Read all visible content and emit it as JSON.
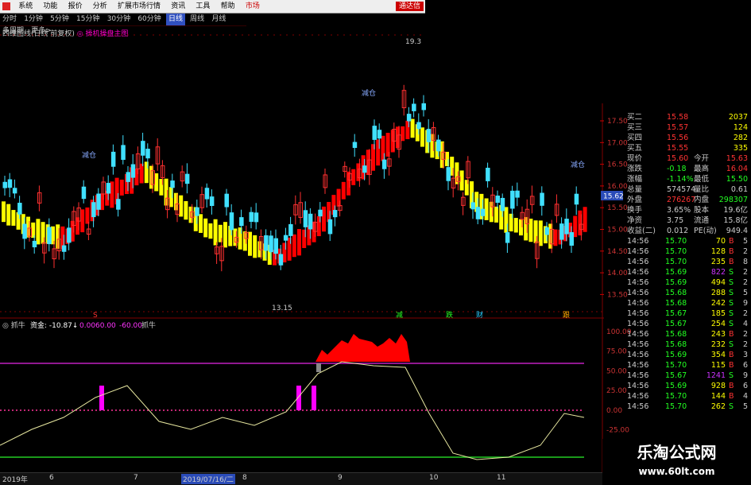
{
  "menu": [
    "系统",
    "功能",
    "报价",
    "分析",
    "扩展市场行情",
    "资讯",
    "工具",
    "帮助",
    "市场"
  ],
  "quick_trade": "通达信",
  "periods": [
    "分时",
    "1分钟",
    "5分钟",
    "15分钟",
    "30分钟",
    "60分钟",
    "日线",
    "周线",
    "月线",
    "多周期",
    "更多>"
  ],
  "active_period": "日线",
  "chart_title": "四维图线(日线 前复权)",
  "chart_title_tag": "◎ 操机操盘主图",
  "price_axis": [
    "17.50",
    "17.00",
    "16.50",
    "16.00",
    "15.50",
    "15.00",
    "14.50",
    "14.00",
    "13.50"
  ],
  "price_flag": "15.62",
  "annotations": {
    "high": "19.3",
    "low": "13.15",
    "reduce1": "减仓",
    "reduce2": "减仓",
    "reduce3": "减仓"
  },
  "signals": [
    "S",
    "减",
    "跌",
    "财",
    "跟"
  ],
  "indicator_header": {
    "name": "◎ 抓牛",
    "funds": "资金: -10.87↓",
    "v1": "0.00",
    "v2": "60.00",
    "v3": "-60.00",
    "name2": "抓牛"
  },
  "indicator_axis": [
    "100.00",
    "75.00",
    "50.00",
    "25.00",
    "0.00",
    "-25.00"
  ],
  "bottom_dates": {
    "d1": "2019年",
    "d2": "6",
    "d3": "7",
    "flag": "2019/07/16/二",
    "d4": "8",
    "d5": "9",
    "d6": "10",
    "d7": "11"
  },
  "quote_book": [
    {
      "label": "买二",
      "price": "15.58",
      "vol": "2037"
    },
    {
      "label": "买三",
      "price": "15.57",
      "vol": "124"
    },
    {
      "label": "买四",
      "price": "15.56",
      "vol": "282"
    },
    {
      "label": "买五",
      "price": "15.55",
      "vol": "335"
    }
  ],
  "quote_stats": [
    {
      "l1": "现价",
      "v1": "15.60",
      "l2": "今开",
      "v2": "15.63"
    },
    {
      "l1": "涨跌",
      "v1": "-0.18",
      "l2": "最高",
      "v2": "16.04"
    },
    {
      "l1": "涨幅",
      "v1": "-1.14%",
      "l2": "最低",
      "v2": "15.50"
    },
    {
      "l1": "总量",
      "v1": "574574",
      "l2": "量比",
      "v2": "0.61"
    },
    {
      "l1": "外盘",
      "v1": "276267",
      "l2": "内盘",
      "v2": "298307"
    },
    {
      "l1": "换手",
      "v1": "3.65%",
      "l2": "股本",
      "v2": "19.6亿"
    },
    {
      "l1": "净资",
      "v1": "3.75",
      "l2": "流通",
      "v2": "15.8亿"
    },
    {
      "l1": "收益(二)",
      "v1": "0.012",
      "l2": "PE(动)",
      "v2": "949.4"
    }
  ],
  "ticks": [
    {
      "t": "14:56",
      "p": "15.70",
      "v": "70",
      "d": "B",
      "n": "5"
    },
    {
      "t": "14:56",
      "p": "15.70",
      "v": "128",
      "d": "B",
      "n": "2"
    },
    {
      "t": "14:56",
      "p": "15.70",
      "v": "235",
      "d": "B",
      "n": "8"
    },
    {
      "t": "14:56",
      "p": "15.69",
      "v": "822",
      "d": "S",
      "n": "2"
    },
    {
      "t": "14:56",
      "p": "15.69",
      "v": "494",
      "d": "S",
      "n": "2"
    },
    {
      "t": "14:56",
      "p": "15.68",
      "v": "288",
      "d": "S",
      "n": "5"
    },
    {
      "t": "14:56",
      "p": "15.68",
      "v": "242",
      "d": "S",
      "n": "9"
    },
    {
      "t": "14:56",
      "p": "15.67",
      "v": "185",
      "d": "S",
      "n": "2"
    },
    {
      "t": "14:56",
      "p": "15.67",
      "v": "254",
      "d": "S",
      "n": "4"
    },
    {
      "t": "14:56",
      "p": "15.68",
      "v": "243",
      "d": "B",
      "n": "2"
    },
    {
      "t": "14:56",
      "p": "15.68",
      "v": "232",
      "d": "S",
      "n": "2"
    },
    {
      "t": "14:56",
      "p": "15.69",
      "v": "354",
      "d": "B",
      "n": "3"
    },
    {
      "t": "14:56",
      "p": "15.70",
      "v": "115",
      "d": "B",
      "n": "6"
    },
    {
      "t": "14:56",
      "p": "15.67",
      "v": "1241",
      "d": "S",
      "n": "9"
    },
    {
      "t": "14:56",
      "p": "15.69",
      "v": "928",
      "d": "B",
      "n": "6"
    },
    {
      "t": "14:56",
      "p": "15.70",
      "v": "144",
      "d": "B",
      "n": "4"
    },
    {
      "t": "14:56",
      "p": "15.70",
      "v": "262",
      "d": "S",
      "n": "5"
    }
  ],
  "watermark": {
    "line1": "乐淘公式网",
    "line2": "www.60lt.com"
  },
  "colors": {
    "up": "#ff2020",
    "down": "#40e0ff",
    "ribbon_up": "#ff0000",
    "ribbon_down": "#ffff00",
    "grid": "#800000",
    "yellow": "#ffd700",
    "green": "#22cc22",
    "magenta": "#ff00ff"
  }
}
